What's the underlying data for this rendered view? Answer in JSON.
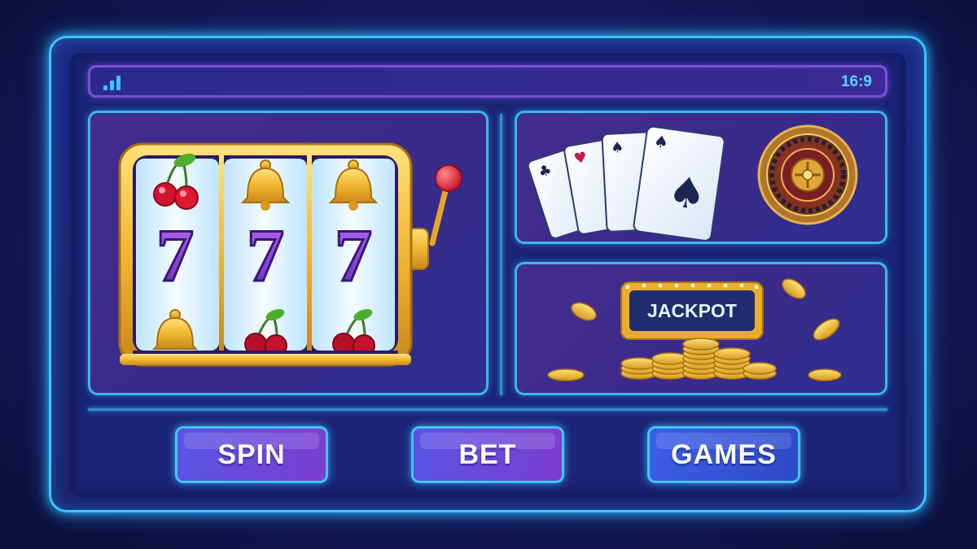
{
  "status_bar": {
    "ratio_label": "16:9",
    "signal_icon": "signal-bars-icon"
  },
  "slot_machine": {
    "reels": [
      [
        "cherries",
        "7",
        "bell"
      ],
      [
        "bell",
        "7",
        "cherries"
      ],
      [
        "bell",
        "7",
        "cherries"
      ]
    ],
    "symbol_seven": "7"
  },
  "jackpot": {
    "label": "JACKPOT"
  },
  "buttons": {
    "spin": "SPIN",
    "bet": "BET",
    "games": "GAMES"
  },
  "colors": {
    "neon_blue": "#39c6ff",
    "purple": "#7b3fd0",
    "gold": "#f2b631"
  }
}
